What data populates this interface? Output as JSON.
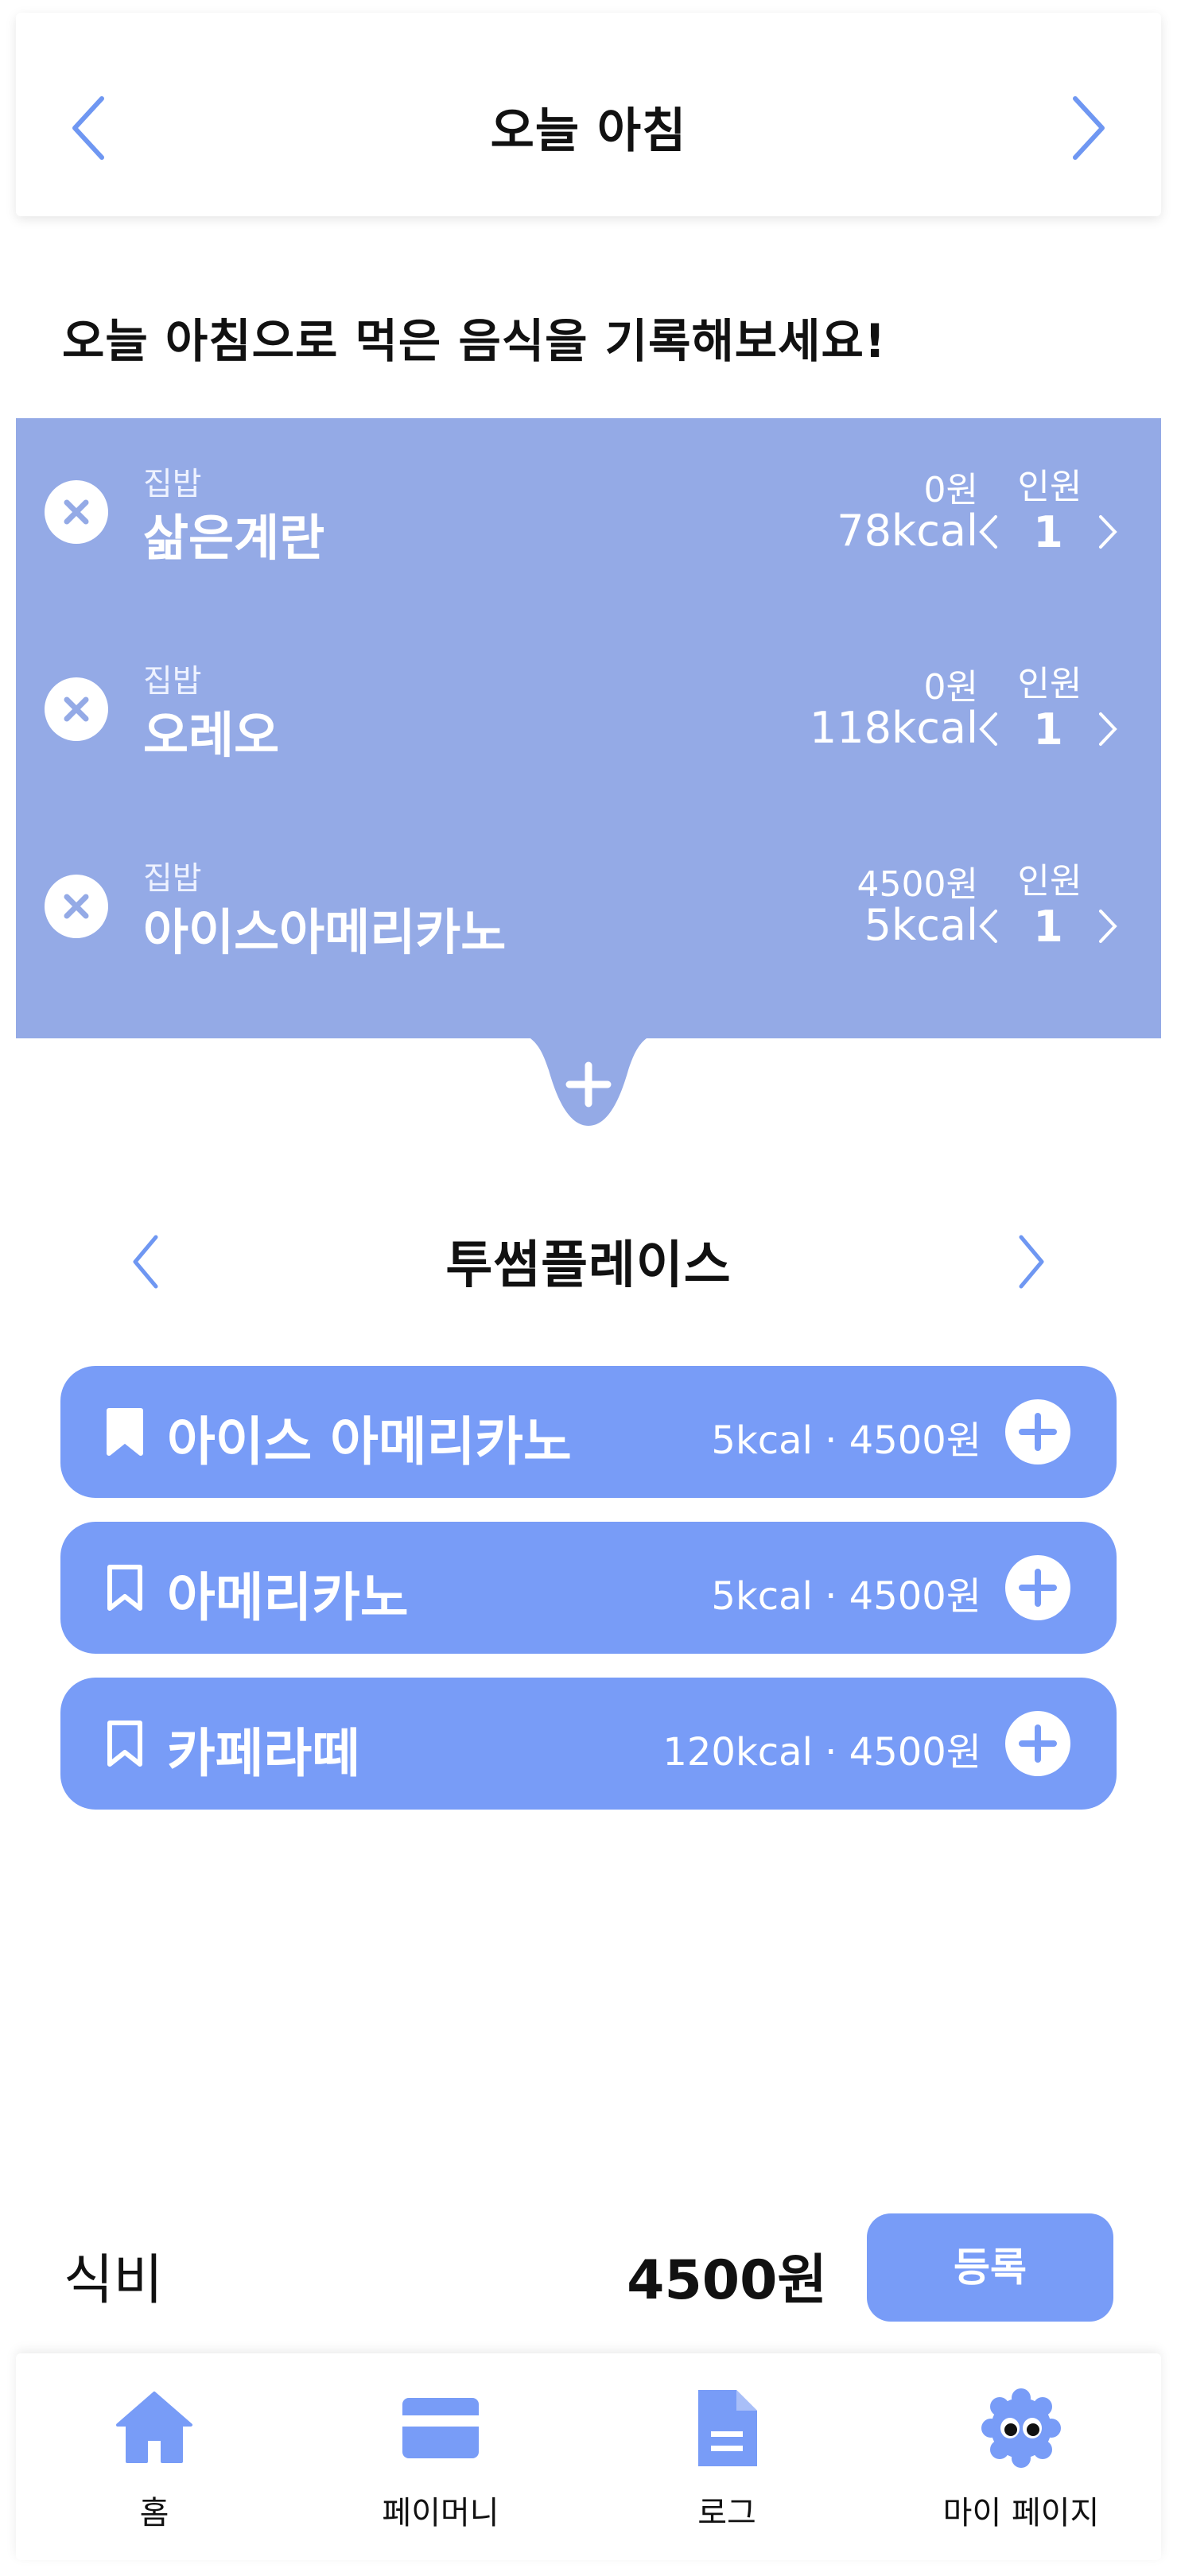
{
  "header": {
    "title": "오늘 아침",
    "prev_icon": "chevron-left-icon",
    "next_icon": "chevron-right-icon"
  },
  "prompt": "오늘 아침으로 먹은 음식을 기록해보세요!",
  "records": [
    {
      "category": "집밥",
      "name": "삶은계란",
      "price": "0원",
      "kcal": "78kcal",
      "people_label": "인원",
      "count": "1"
    },
    {
      "category": "집밥",
      "name": "오레오",
      "price": "0원",
      "kcal": "118kcal",
      "people_label": "인원",
      "count": "1"
    },
    {
      "category": "집밥",
      "name": "아이스아메리카노",
      "price": "4500원",
      "kcal": "5kcal",
      "people_label": "인원",
      "count": "1"
    }
  ],
  "place": {
    "title": "투썸플레이스"
  },
  "menus": [
    {
      "name": "아이스 아메리카노",
      "info": "5kcal · 4500원",
      "bookmarked": true
    },
    {
      "name": "아메리카노",
      "info": "5kcal · 4500원",
      "bookmarked": false
    },
    {
      "name": "카페라떼",
      "info": "120kcal · 4500원",
      "bookmarked": false
    }
  ],
  "footer": {
    "cost_label": "식비",
    "cost_value": "4500원",
    "register_label": "등록"
  },
  "tabs": [
    {
      "label": "홈",
      "icon": "home-icon"
    },
    {
      "label": "페이머니",
      "icon": "card-icon"
    },
    {
      "label": "로그",
      "icon": "document-icon"
    },
    {
      "label": "마이 페이지",
      "icon": "character-icon"
    }
  ],
  "colors": {
    "accent": "#789cf7",
    "panel": "#94aae6",
    "arrow": "#6f97f2"
  }
}
